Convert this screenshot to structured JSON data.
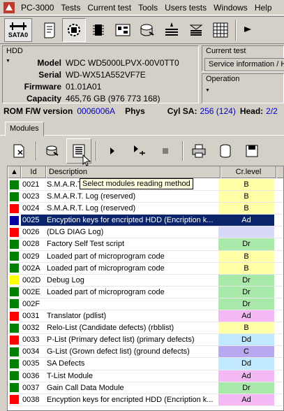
{
  "app": {
    "menu": [
      "PC-3000",
      "Tests",
      "Current test",
      "Tools",
      "Users tests",
      "Windows",
      "Help"
    ]
  },
  "toolbar": {
    "sata_label": "SATA0"
  },
  "hdd": {
    "title": "HDD",
    "fields": [
      {
        "label": "Model",
        "value": "WDC WD5000LPVX-00V0TT0"
      },
      {
        "label": "Serial",
        "value": "WD-WX51A552VF7E"
      },
      {
        "label": "Firmware",
        "value": "01.01A01"
      },
      {
        "label": "Capacity",
        "value": "465,76 GB (976 773 168)"
      }
    ]
  },
  "current_test": {
    "title": "Current test",
    "value": "Service information / H"
  },
  "operation": {
    "title": "Operation"
  },
  "rom": {
    "label": "ROM F/W version",
    "value": "0006006A",
    "phys": "Phys",
    "cyl_label": "Cyl SA:",
    "cyl_value": "256 (124)",
    "head_label": "Head:",
    "head_value": "2/2"
  },
  "tabs": [
    "Modules"
  ],
  "tooltip": "Select modules reading method",
  "grid": {
    "columns": {
      "id": "Id",
      "desc": "Description",
      "level": "Cr.level"
    },
    "rows": [
      {
        "status": "#008000",
        "id": "0021",
        "desc": "S.M.A.R.T. Log",
        "level": "B",
        "level_color": "#ffffa8"
      },
      {
        "status": "#008000",
        "id": "0023",
        "desc": "S.M.A.R.T. Log (reserved)",
        "level": "B",
        "level_color": "#ffffa8"
      },
      {
        "status": "#ff0000",
        "id": "0024",
        "desc": "S.M.A.R.T. Log (reserved)",
        "level": "B",
        "level_color": "#ffffa8"
      },
      {
        "status": "#0000a0",
        "id": "0025",
        "desc": "Encyption keys for encripted HDD (Encription k...",
        "level": "Ad",
        "level_color": "#0a246a",
        "selected": true
      },
      {
        "status": "#ff0000",
        "id": "0026",
        "desc": " (DLG DIAG Log)",
        "level": "",
        "level_color": "#d8d8f8"
      },
      {
        "status": "#008000",
        "id": "0028",
        "desc": "Factory Self Test script",
        "level": "Dr",
        "level_color": "#a8e8a8"
      },
      {
        "status": "#008000",
        "id": "0029",
        "desc": "Loaded part of microprogram code",
        "level": "B",
        "level_color": "#ffffa8"
      },
      {
        "status": "#008000",
        "id": "002A",
        "desc": "Loaded part of microprogram code",
        "level": "B",
        "level_color": "#ffffa8"
      },
      {
        "status": "#ffff00",
        "id": "002D",
        "desc": "Debug Log",
        "level": "Dr",
        "level_color": "#a8e8a8"
      },
      {
        "status": "#008000",
        "id": "002E",
        "desc": "Loaded part of microprogram code",
        "level": "Dr",
        "level_color": "#a8e8a8"
      },
      {
        "status": "#008000",
        "id": "002F",
        "desc": "",
        "level": "Dr",
        "level_color": "#a8e8a8"
      },
      {
        "status": "#ff0000",
        "id": "0031",
        "desc": "Translator (pdlist)",
        "level": "Ad",
        "level_color": "#f4b8f4"
      },
      {
        "status": "#008000",
        "id": "0032",
        "desc": "Relo-List (Candidate defects) (rbblist)",
        "level": "B",
        "level_color": "#ffffa8"
      },
      {
        "status": "#ff0000",
        "id": "0033",
        "desc": "P-List (Primary defect list) (primary defects)",
        "level": "Dd",
        "level_color": "#c0e8ff"
      },
      {
        "status": "#008000",
        "id": "0034",
        "desc": "G-List (Grown defect list) (ground defects)",
        "level": "C",
        "level_color": "#b8a8f0"
      },
      {
        "status": "#008000",
        "id": "0035",
        "desc": "SA Defects",
        "level": "Dd",
        "level_color": "#c0e8ff"
      },
      {
        "status": "#008000",
        "id": "0036",
        "desc": "T-List Module",
        "level": "Ad",
        "level_color": "#f4b8f4"
      },
      {
        "status": "#008000",
        "id": "0037",
        "desc": "Gain Call Data Module",
        "level": "Dr",
        "level_color": "#a8e8a8"
      },
      {
        "status": "#ff0000",
        "id": "0038",
        "desc": "Encyption keys for encripted HDD (Encription k...",
        "level": "Ad",
        "level_color": "#f4b8f4"
      }
    ]
  },
  "colors": {
    "face": "#d4d0c8",
    "selection": "#0a246a",
    "rom_value_blue": "#0000c8"
  }
}
